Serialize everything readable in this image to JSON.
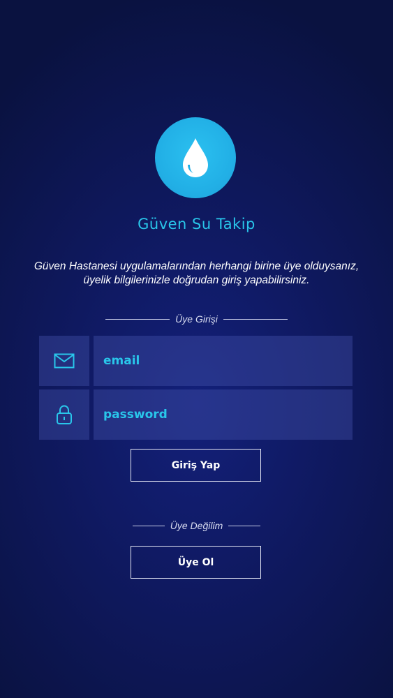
{
  "app": {
    "title": "Güven Su Takip",
    "logo_icon": "water-drop-icon",
    "intro_text": "Güven Hastanesi uygulamalarından herhangi birine üye olduysanız, üyelik bilgilerinizle doğrudan giriş yapabilirsiniz."
  },
  "login": {
    "section_label": "Üye Girişi",
    "email_placeholder": "email",
    "email_icon": "mail-icon",
    "password_placeholder": "password",
    "password_icon": "lock-icon",
    "submit_label": "Giriş Yap"
  },
  "signup": {
    "section_label": "Üye Değilim",
    "button_label": "Üye Ol"
  },
  "colors": {
    "background": "#0f1960",
    "accent": "#29c6ea",
    "logo_circle": "#22b0e6",
    "field_background": "#2c3a8a",
    "text": "#ffffff"
  }
}
